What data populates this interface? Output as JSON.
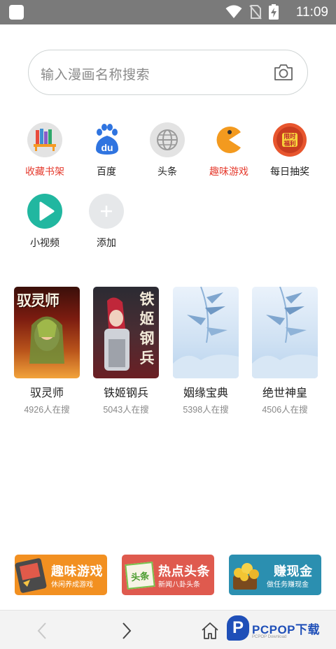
{
  "status_bar": {
    "time": "11:09"
  },
  "search": {
    "placeholder": "输入漫画名称搜索"
  },
  "shortcuts": [
    {
      "label": "收藏书架",
      "icon": "bookshelf-icon",
      "highlight": true
    },
    {
      "label": "百度",
      "icon": "baidu-paw-icon",
      "highlight": false
    },
    {
      "label": "头条",
      "icon": "globe-icon",
      "highlight": false
    },
    {
      "label": "趣味游戏",
      "icon": "pacman-icon",
      "highlight": true
    },
    {
      "label": "每日抽奖",
      "icon": "lottery-wheel-icon",
      "highlight": false,
      "badge": "限时福利"
    },
    {
      "label": "小视频",
      "icon": "play-icon",
      "highlight": false
    },
    {
      "label": "添加",
      "icon": "plus-icon",
      "highlight": false
    }
  ],
  "comics": [
    {
      "title": "驭灵师",
      "count": "4926人在搜",
      "cover_text": "驭灵师"
    },
    {
      "title": "铁姬钢兵",
      "count": "5043人在搜",
      "cover_text": "铁姬钢兵"
    },
    {
      "title": "姻缘宝典",
      "count": "5398人在搜"
    },
    {
      "title": "绝世神皇",
      "count": "4506人在搜"
    }
  ],
  "banners": [
    {
      "title": "趣味游戏",
      "subtitle": "休闲养成游戏",
      "color": "#f29021"
    },
    {
      "title": "热点头条",
      "subtitle": "新闻八卦头条",
      "color": "#df5a4e",
      "tag": "头条"
    },
    {
      "title": "赚现金",
      "subtitle": "做任务赚现金",
      "color": "#2b8fb0"
    }
  ],
  "watermark": {
    "logo": "P",
    "text": "PCPOP下载",
    "subtext": "PCPOP Download"
  },
  "colors": {
    "highlight_red": "#e53b2e",
    "status_bar": "#7a7a7a",
    "bottom_nav": "#f3f3f3"
  }
}
